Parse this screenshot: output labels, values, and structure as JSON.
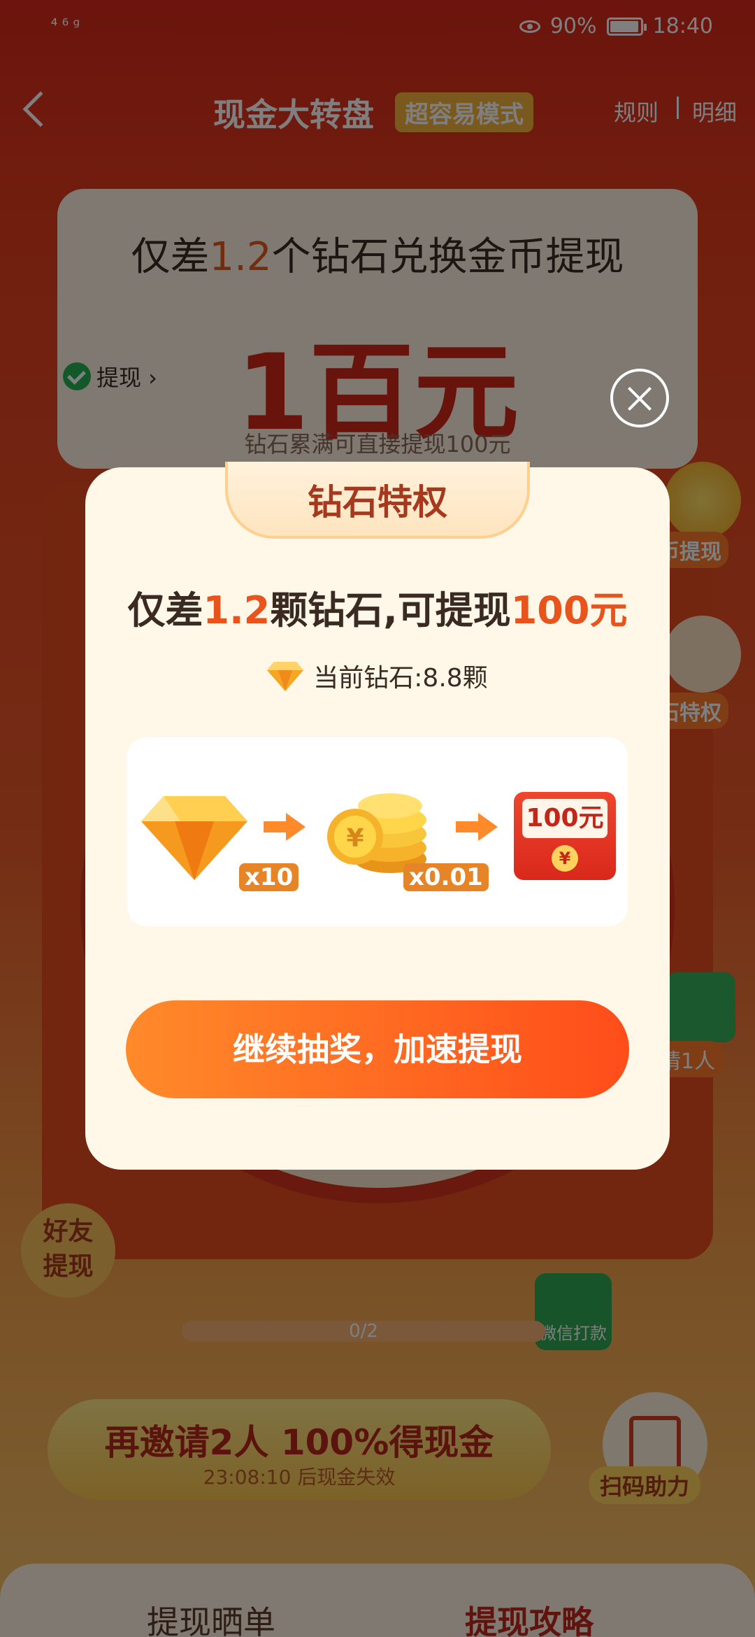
{
  "status_bar": {
    "signal": "⁴⁶ᵍ",
    "battery": "90%",
    "time": "18:40"
  },
  "nav": {
    "title": "现金大转盘",
    "badge": "超容易模式",
    "rules": "规则",
    "detail": "明细"
  },
  "background": {
    "headline_prefix": "仅差",
    "headline_num": "1.2",
    "headline_suffix": "个钻石兑换金币提现",
    "amount": "1百元",
    "subtext": "钻石累满可直接提现100元",
    "withdraw_chip": "提现 ›",
    "side_coin_label": "币提现",
    "side_gem_label": "石特权",
    "side_invite_label": "请1人",
    "friend_badge_line1": "好友",
    "friend_badge_line2": "提现",
    "wechat_pay": "微信打款",
    "progress": "0/2",
    "invite_title": "再邀请2人 100%得现金",
    "invite_timer": "23:08:10 后现金失效",
    "scan_label": "扫码助力",
    "tab_left": "提现晒单",
    "tab_right": "提现攻略"
  },
  "modal": {
    "tab_title": "钻石特权",
    "headline_prefix": "仅差",
    "headline_num": "1.2",
    "headline_mid": "颗钻石,可提现",
    "headline_amount": "100元",
    "current_label": "当前钻石:8.8颗",
    "exchange": {
      "gem_qty": "x10",
      "coin_qty": "x0.01",
      "envelope_label": "100元",
      "envelope_seal": "¥"
    },
    "cta_label": "继续抽奖，加速提现"
  },
  "colors": {
    "accent": "#e8541c",
    "brand_red": "#c2271a",
    "cta_start": "#ff8a2a",
    "cta_end": "#ff4d1a",
    "modal_bg": "#fff8e8"
  }
}
